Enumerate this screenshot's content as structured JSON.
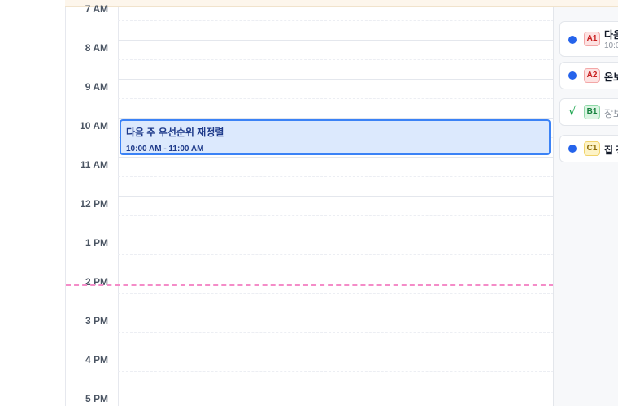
{
  "calendar": {
    "hours": [
      {
        "label": "7 AM"
      },
      {
        "label": "8 AM"
      },
      {
        "label": "9 AM"
      },
      {
        "label": "10 AM"
      },
      {
        "label": "11 AM"
      },
      {
        "label": "12 PM"
      },
      {
        "label": "1 PM"
      },
      {
        "label": "2 PM"
      },
      {
        "label": "3 PM"
      },
      {
        "label": "4 PM"
      },
      {
        "label": "5 PM"
      }
    ],
    "event": {
      "title": "다음 주 우선순위 재정렬",
      "time": "10:00 AM - 11:00 AM",
      "color": "#3b82f6"
    },
    "now_indicator_color": "#f48cc8"
  },
  "tasks": [
    {
      "status_icon": "dot-icon",
      "badge": "A1",
      "title": "다음",
      "subtitle": "10:0"
    },
    {
      "status_icon": "dot-icon",
      "badge": "A2",
      "title": "온보"
    },
    {
      "status_icon": "check-icon",
      "badge": "B1",
      "title": "장보"
    },
    {
      "status_icon": "dot-icon",
      "badge": "C1",
      "title": "집 정"
    }
  ],
  "colors": {
    "priority_a": "#c81e1e",
    "priority_b": "#15803d",
    "priority_c": "#8a6a06",
    "status_dot": "#2563eb"
  }
}
